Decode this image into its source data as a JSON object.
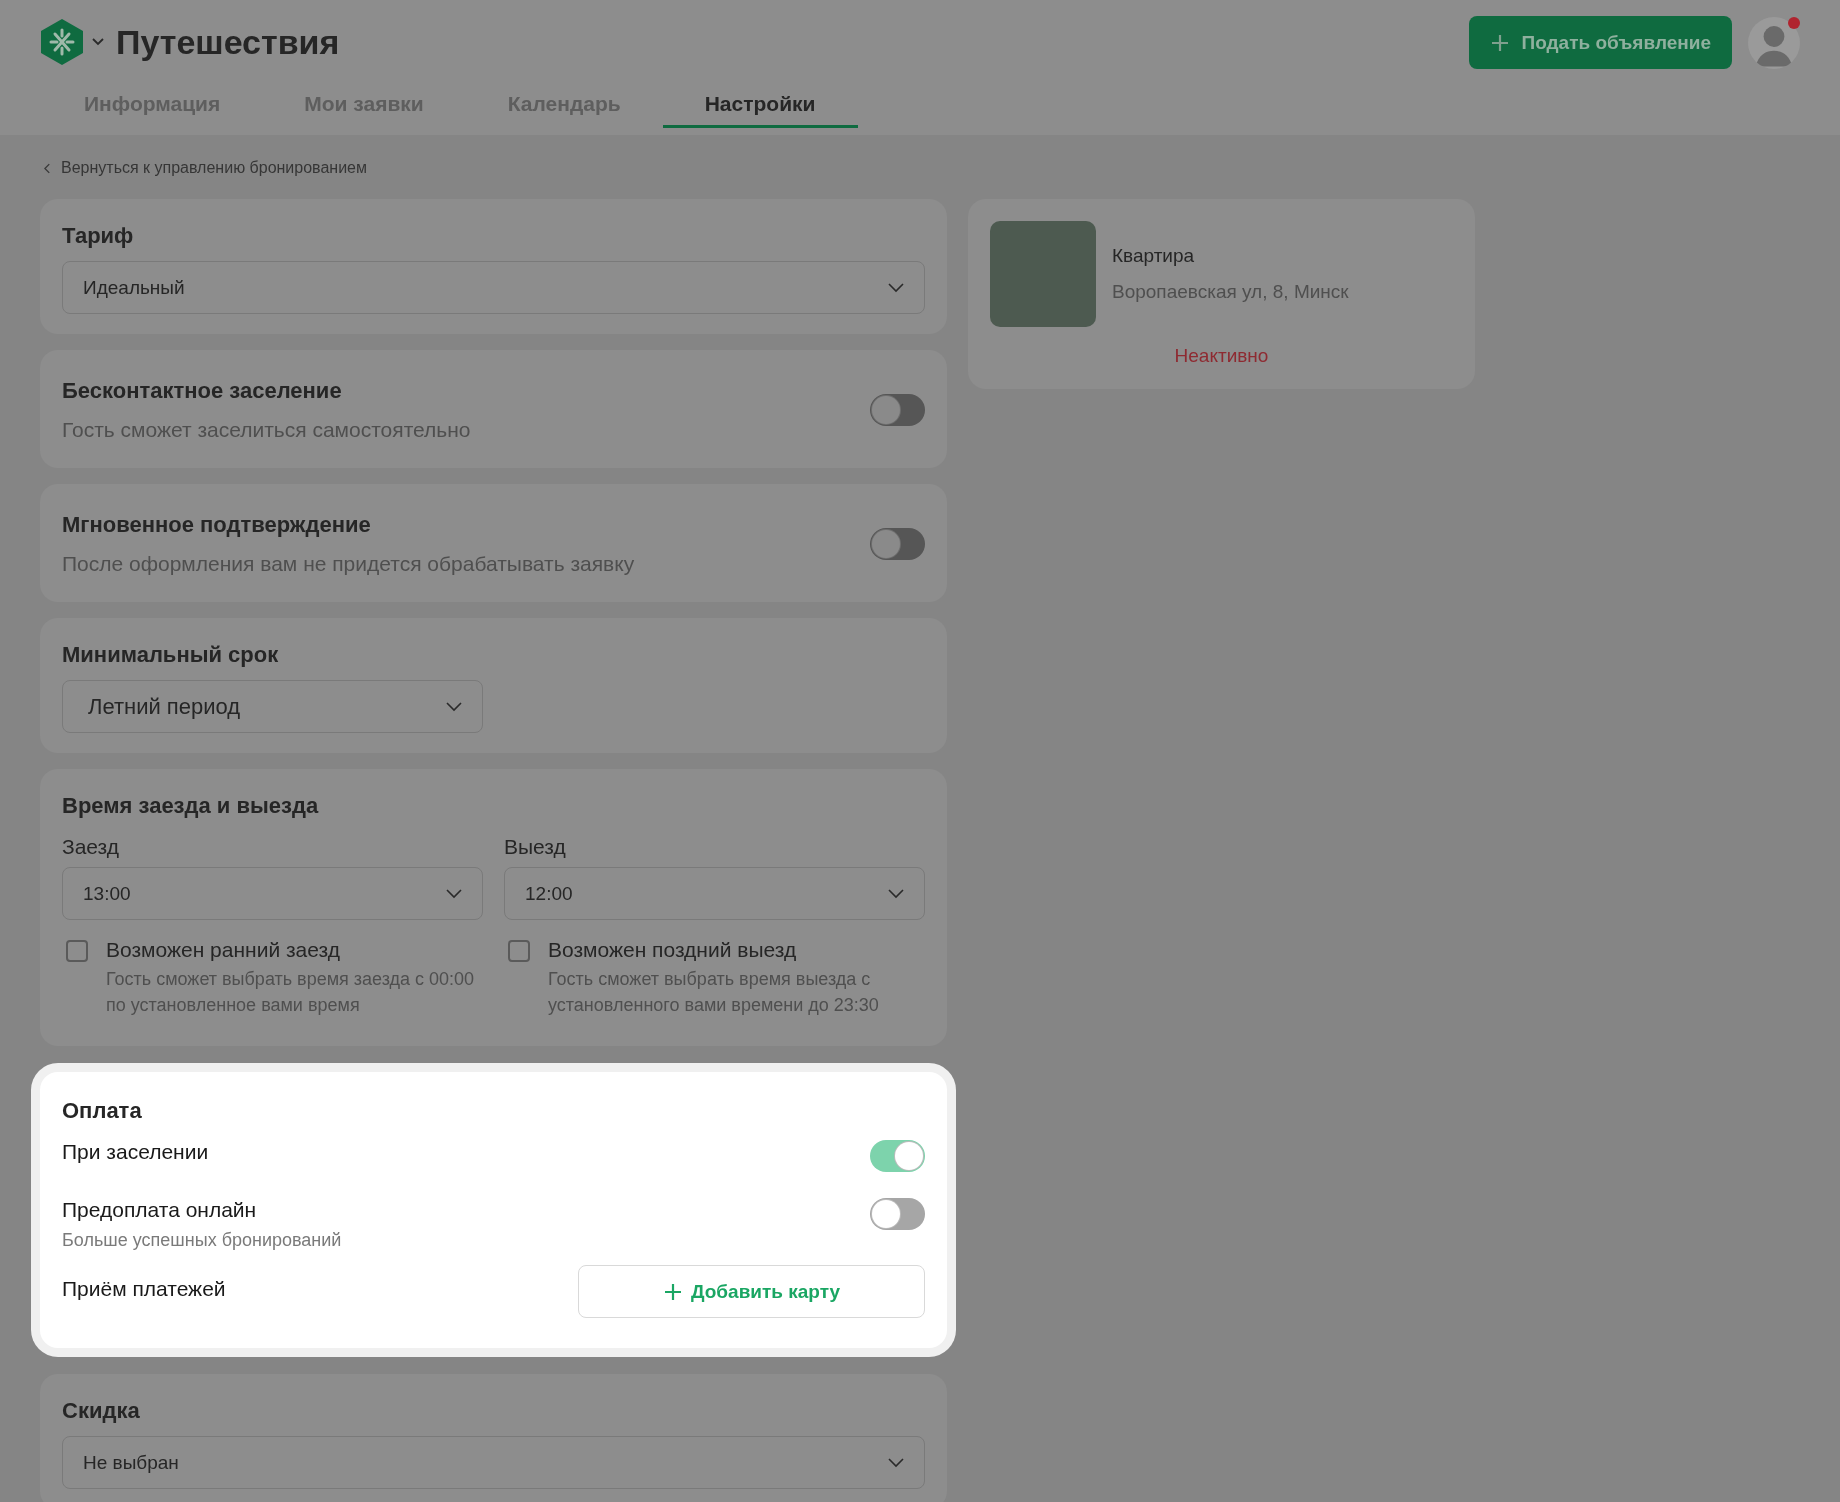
{
  "header": {
    "title": "Путешествия",
    "post_button": "Подать объявление"
  },
  "tabs": [
    {
      "label": "Информация",
      "selected": false
    },
    {
      "label": "Мои заявки",
      "selected": false
    },
    {
      "label": "Календарь",
      "selected": false
    },
    {
      "label": "Настройки",
      "selected": true
    }
  ],
  "back_link": "Вернуться к управлению бронированием",
  "settings": [
    {
      "kind": "select",
      "title": "Тариф",
      "value": "Идеальный",
      "narrow": false,
      "highlighted": false
    },
    {
      "kind": "toggle",
      "title": "Бесконтактное заселение",
      "description": "Гость сможет заселиться самостоятельно",
      "on": false,
      "highlighted": false
    },
    {
      "kind": "toggle",
      "title": "Мгновенное подтверждение",
      "description": "После оформления вам не придется обрабатывать заявку",
      "on": false,
      "highlighted": false
    },
    {
      "kind": "select",
      "title": "Минимальный срок",
      "value": "Летний период",
      "narrow": true,
      "highlighted": false
    },
    {
      "kind": "times",
      "title": "Время заезда и выезда",
      "highlighted": false,
      "columns": [
        {
          "label": "Заезд",
          "value": "13:00",
          "option": "Возможен ранний заезд",
          "description": "Гость сможет выбрать время заезда с 00:00 по установленное вами время",
          "checked": false
        },
        {
          "label": "Выезд",
          "value": "12:00",
          "option": "Возможен поздний выезд",
          "description": "Гость сможет выбрать время выезда с установленного вами времени до 23:30",
          "checked": false
        }
      ]
    },
    {
      "kind": "payment",
      "title": "Оплата",
      "highlighted": true,
      "options": [
        {
          "label": "При заселении",
          "on": true
        },
        {
          "label": "Предоплата онлайн",
          "description": "Больше успешных бронирований",
          "on": false
        }
      ],
      "method_label": "Приём платежей",
      "method_button": "Добавить карту"
    },
    {
      "kind": "select",
      "title": "Скидка",
      "value": "Не выбран",
      "narrow": false,
      "highlighted": false
    }
  ],
  "listing": {
    "title": "Квартира",
    "address": "Воропаевская ул, 8, Минск",
    "status": "Неактивно"
  }
}
